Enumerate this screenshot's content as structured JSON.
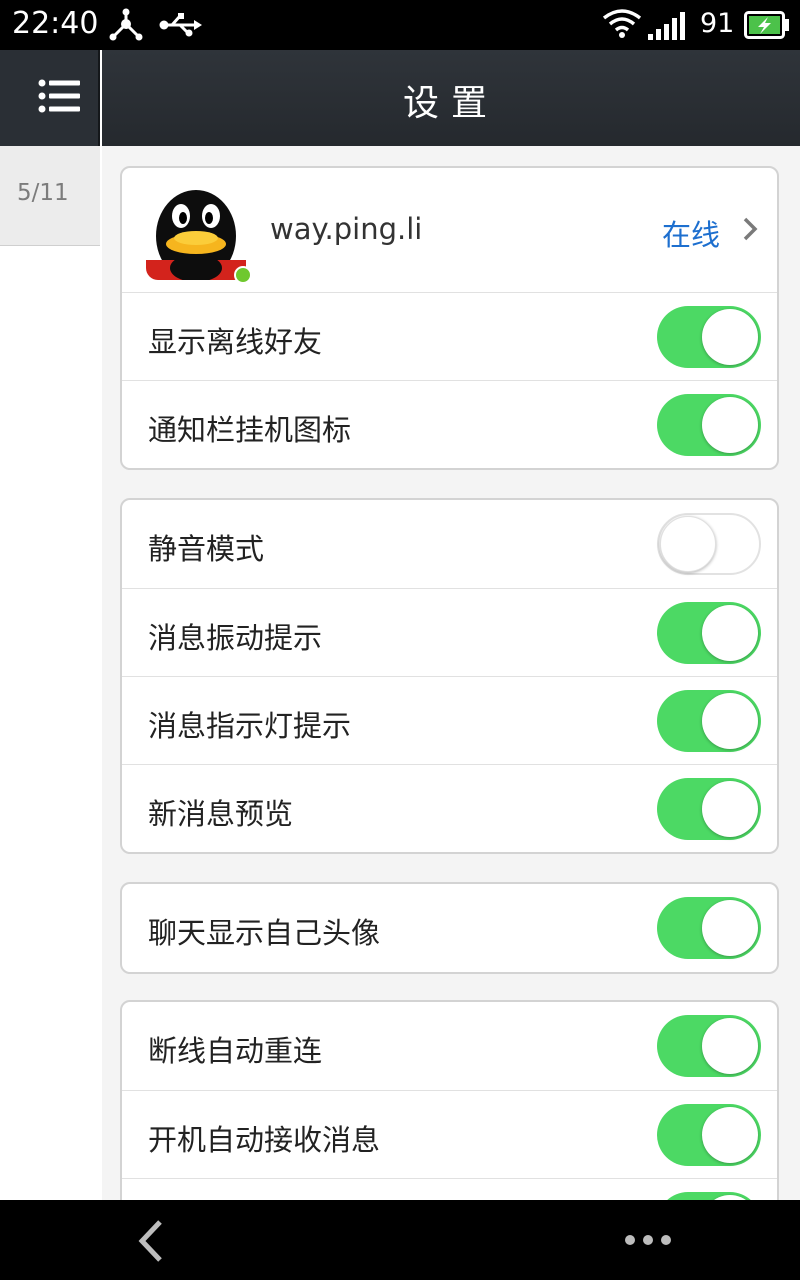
{
  "status_bar": {
    "time": "22:40",
    "battery_level": "91",
    "icons": [
      "usb-tether-icon",
      "usb-icon",
      "wifi-icon",
      "signal-icon",
      "battery-charging-icon"
    ]
  },
  "left_panel": {
    "date": "5/11",
    "menu_icon": "list-menu-icon"
  },
  "header": {
    "title": "设置"
  },
  "profile": {
    "username": "way.ping.li",
    "status": "在线",
    "avatar_icon": "qq-penguin-avatar"
  },
  "groups": [
    {
      "rows": [
        {
          "label": "显示离线好友",
          "on": true
        },
        {
          "label": "通知栏挂机图标",
          "on": true
        }
      ]
    },
    {
      "rows": [
        {
          "label": "静音模式",
          "on": false
        },
        {
          "label": "消息振动提示",
          "on": true
        },
        {
          "label": "消息指示灯提示",
          "on": true
        },
        {
          "label": "新消息预览",
          "on": true
        }
      ]
    },
    {
      "rows": [
        {
          "label": "聊天显示自己头像",
          "on": true
        }
      ]
    },
    {
      "rows": [
        {
          "label": "断线自动重连",
          "on": true
        },
        {
          "label": "开机自动接收消息",
          "on": true
        }
      ]
    }
  ],
  "colors": {
    "toggle_on": "#4cd964",
    "accent_link": "#1d6fcf",
    "header_bg": "#2a2f35"
  },
  "nav_bar": {
    "icons": [
      "back-icon",
      "more-icon"
    ]
  }
}
